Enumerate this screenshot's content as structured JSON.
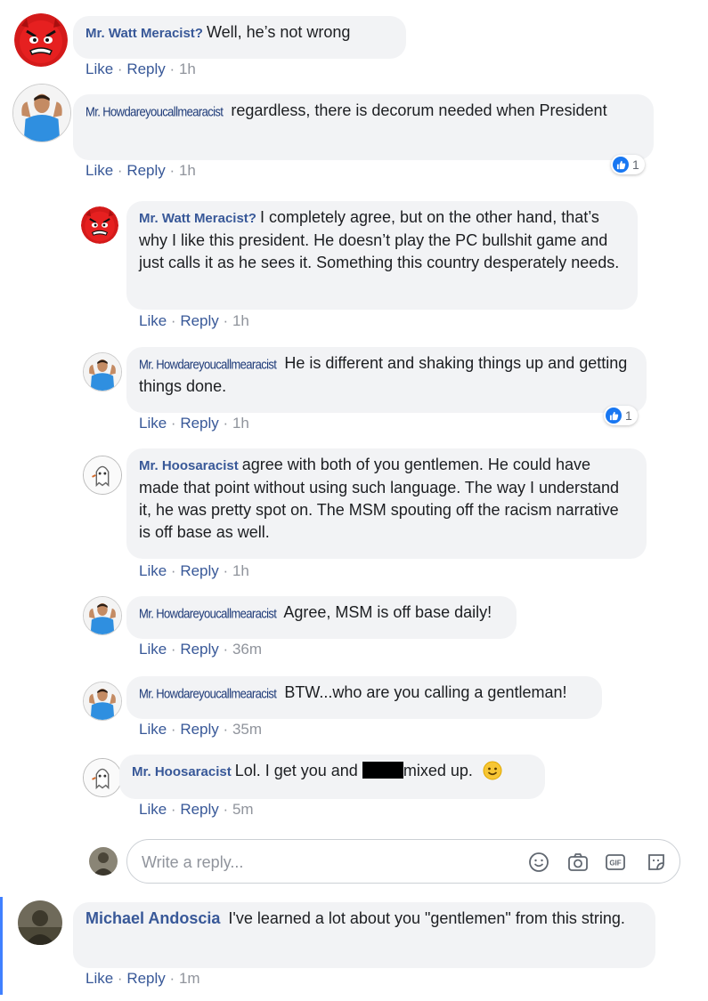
{
  "comments": [
    {
      "author": "Mr. Watt Meracist?",
      "text": "Well, he’s not wrong",
      "like": "Like",
      "reply": "Reply",
      "time": "1h"
    },
    {
      "author": "Mr. Howdareyoucallmearacist",
      "text": "regardless, there is decorum needed when President",
      "like": "Like",
      "reply": "Reply",
      "time": "1h",
      "reactions": "1"
    },
    {
      "author": "Mr. Watt Meracist?",
      "text": "I completely agree, but on the other hand, that’s why I like this president. He doesn’t play the PC bullshit game and just calls it as he sees it. Something this country desperately needs.",
      "like": "Like",
      "reply": "Reply",
      "time": "1h"
    },
    {
      "author": "Mr. Howdareyoucallmearacist",
      "text": "He is different and shaking things up and getting things done.",
      "like": "Like",
      "reply": "Reply",
      "time": "1h",
      "reactions": "1"
    },
    {
      "author": "Mr. Hoosaracist",
      "text": "agree with both of you gentlemen. He could have made that point without using such language. The way I understand it, he was pretty spot on. The MSM spouting off the racism narrative is off base as well.",
      "like": "Like",
      "reply": "Reply",
      "time": "1h"
    },
    {
      "author": "Mr. Howdareyoucallmearacist",
      "text": "Agree, MSM is off base daily!",
      "like": "Like",
      "reply": "Reply",
      "time": "36m"
    },
    {
      "author": "Mr. Howdareyoucallmearacist",
      "text": "BTW...who are you calling a gentleman!",
      "like": "Like",
      "reply": "Reply",
      "time": "35m"
    },
    {
      "author": "Mr. Hoosaracist",
      "text_before": "Lol. I get you and",
      "text_after": "mixed up.",
      "like": "Like",
      "reply": "Reply",
      "time": "5m"
    },
    {
      "author": "Michael Andoscia",
      "text": "I've learned a lot about you \"gentlemen\" from this string.",
      "like": "Like",
      "reply": "Reply",
      "time": "1m"
    }
  ],
  "reply_box": {
    "placeholder": "Write a reply..."
  },
  "separator": "·",
  "colors": {
    "link": "#385898",
    "bubble": "#f2f3f5",
    "meta": "#90949c",
    "accent": "#4080ff"
  },
  "icons": [
    "emoji-icon",
    "camera-icon",
    "gif-icon",
    "sticker-icon",
    "like-reaction-icon",
    "smiley-emoji-icon"
  ]
}
